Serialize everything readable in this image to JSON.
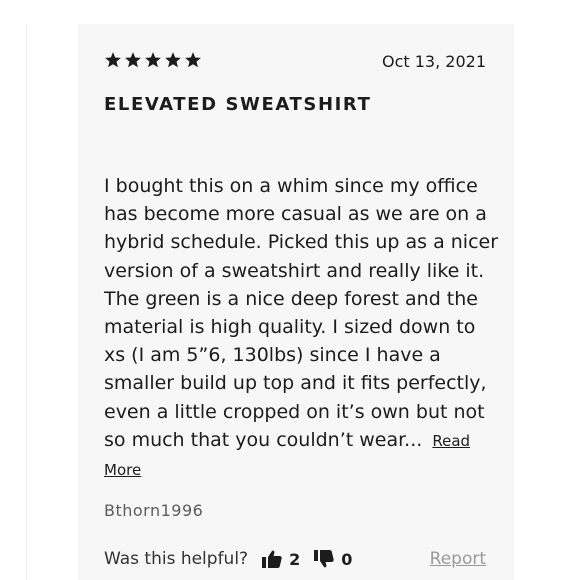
{
  "review": {
    "rating": 5,
    "rating_max": 5,
    "date": "Oct 13, 2021",
    "title": "ELEVATED SWEATSHIRT",
    "body": "I bought this on a whim since my office has become more casual as we are on a hybrid schedule. Picked this up as a nicer version of a sweatshirt and really like it. The green is a nice deep forest and the material is high quality. I sized down to xs (I am 5”6, 130lbs) since I have a smaller build up top and it fits perfectly, even a little cropped on it’s own but not so much that you couldn’t wear...",
    "read_more_label": "Read More",
    "author": "Bthorn1996"
  },
  "feedback": {
    "helpful_label": "Was this helpful?",
    "upvotes": "2",
    "downvotes": "0",
    "report_label": "Report"
  },
  "icons": {
    "star": "star-icon",
    "thumbs_up": "thumbs-up-icon",
    "thumbs_down": "thumbs-down-icon"
  },
  "colors": {
    "card_background": "#f7f7f7",
    "text": "#1c1c1c",
    "muted": "#9a9a9a"
  }
}
